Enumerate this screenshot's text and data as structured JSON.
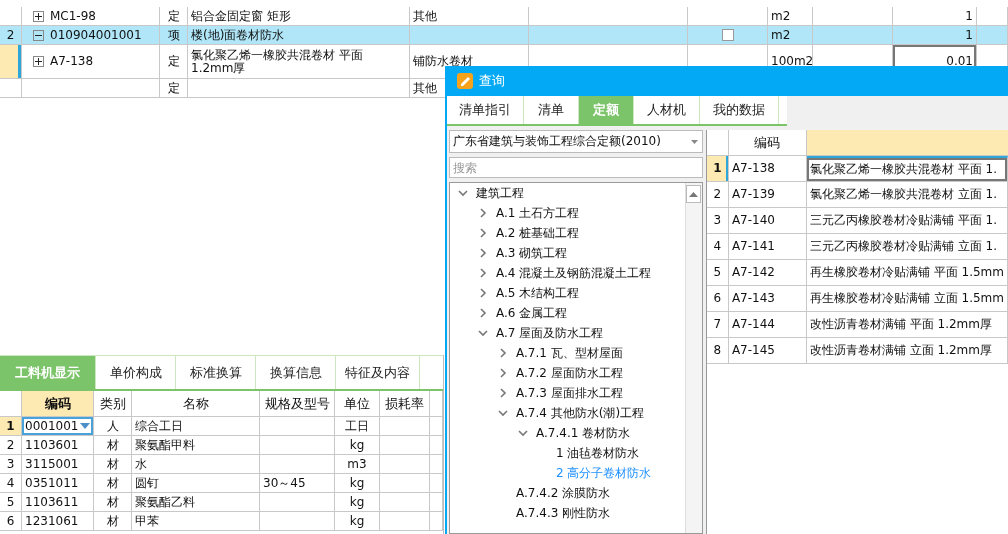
{
  "bill_table": {
    "rows": [
      {
        "no": "",
        "code": "MC1-98",
        "expanded": false,
        "type": "定",
        "name": "铝合金固定窗 矩形",
        "column_5": "其他",
        "unit": "m2",
        "qty": "1",
        "selected": false,
        "current": false
      },
      {
        "no": "2",
        "code": "010904001001",
        "expanded": true,
        "type": "项",
        "name": "楼(地)面卷材防水",
        "checkbox": false,
        "unit": "m2",
        "qty": "1",
        "selected": true,
        "current": false
      },
      {
        "no": "",
        "code": "A7-138",
        "expanded": false,
        "type": "定",
        "name": "氯化聚乙烯一橡胶共混卷材 平面 1.2mm厚",
        "column_5": "铺防水卷材",
        "unit": "100m2",
        "qty": "0.01",
        "selected": false,
        "current": true
      },
      {
        "no": "",
        "code": "",
        "type": "定",
        "name": "",
        "column_5": "其他",
        "unit": "",
        "qty": "",
        "selected": false,
        "current": false
      }
    ]
  },
  "detail_panel": {
    "tabs": [
      {
        "label": "工料机显示",
        "selected": true
      },
      {
        "label": "单价构成",
        "selected": false
      },
      {
        "label": "标准换算",
        "selected": false
      },
      {
        "label": "换算信息",
        "selected": false
      },
      {
        "label": "特征及内容",
        "selected": false
      }
    ],
    "columns": [
      {
        "label": "编码",
        "selected": true
      },
      {
        "label": "类别",
        "selected": false
      },
      {
        "label": "名称",
        "selected": false
      },
      {
        "label": "规格及型号",
        "selected": false
      },
      {
        "label": "单位",
        "selected": false
      },
      {
        "label": "损耗率",
        "selected": false
      }
    ],
    "rows": [
      {
        "no": "1",
        "code": "0001001",
        "type": "人",
        "name": "综合工日",
        "spec": "",
        "unit": "工日",
        "current": true
      },
      {
        "no": "2",
        "code": "1103601",
        "type": "材",
        "name": "聚氨酯甲料",
        "spec": "",
        "unit": "kg",
        "current": false
      },
      {
        "no": "3",
        "code": "3115001",
        "type": "材",
        "name": "水",
        "spec": "",
        "unit": "m3",
        "current": false
      },
      {
        "no": "4",
        "code": "0351011",
        "type": "材",
        "name": "圆钉",
        "spec": "30～45",
        "unit": "kg",
        "current": false
      },
      {
        "no": "5",
        "code": "1103611",
        "type": "材",
        "name": "聚氨酯乙料",
        "spec": "",
        "unit": "kg",
        "current": false
      },
      {
        "no": "6",
        "code": "1231061",
        "type": "材",
        "name": "甲苯",
        "spec": "",
        "unit": "kg",
        "current": false
      }
    ]
  },
  "query_dialog": {
    "title": "查询",
    "tabs": [
      {
        "label": "清单指引",
        "selected": false
      },
      {
        "label": "清单",
        "selected": false
      },
      {
        "label": "定额",
        "selected": true
      },
      {
        "label": "人材机",
        "selected": false
      },
      {
        "label": "我的数据",
        "selected": false
      }
    ],
    "library": "广东省建筑与装饰工程综合定额(2010)",
    "search": {
      "placeholder": "搜索"
    },
    "tree": [
      {
        "label": "建筑工程",
        "kind": "branch",
        "expanded": true,
        "selected": false,
        "children": [
          {
            "label": "A.1 土石方工程",
            "kind": "branch",
            "expanded": false,
            "selected": false
          },
          {
            "label": "A.2 桩基础工程",
            "kind": "branch",
            "expanded": false,
            "selected": false
          },
          {
            "label": "A.3 砌筑工程",
            "kind": "branch",
            "expanded": false,
            "selected": false
          },
          {
            "label": "A.4 混凝土及钢筋混凝土工程",
            "kind": "branch",
            "expanded": false,
            "selected": false
          },
          {
            "label": "A.5 木结构工程",
            "kind": "branch",
            "expanded": false,
            "selected": false
          },
          {
            "label": "A.6 金属工程",
            "kind": "branch",
            "expanded": false,
            "selected": false
          },
          {
            "label": "A.7 屋面及防水工程",
            "kind": "branch",
            "expanded": true,
            "selected": false,
            "children": [
              {
                "label": "A.7.1 瓦、型材屋面",
                "kind": "branch",
                "expanded": false,
                "selected": false
              },
              {
                "label": "A.7.2 屋面防水工程",
                "kind": "branch",
                "expanded": false,
                "selected": false
              },
              {
                "label": "A.7.3 屋面排水工程",
                "kind": "branch",
                "expanded": false,
                "selected": false
              },
              {
                "label": "A.7.4 其他防水(潮)工程",
                "kind": "branch",
                "expanded": true,
                "selected": false,
                "children": [
                  {
                    "label": "A.7.4.1 卷材防水",
                    "kind": "branch",
                    "expanded": true,
                    "selected": false,
                    "children": [
                      {
                        "label": "1 油毡卷材防水",
                        "kind": "leaf",
                        "selected": false
                      },
                      {
                        "label": "2 高分子卷材防水",
                        "kind": "leaf",
                        "selected": true
                      }
                    ]
                  },
                  {
                    "label": "A.7.4.2 涂膜防水",
                    "kind": "leaf",
                    "selected": false
                  },
                  {
                    "label": "A.7.4.3 刚性防水",
                    "kind": "leaf",
                    "selected": false
                  }
                ]
              }
            ]
          }
        ]
      }
    ],
    "results": {
      "columns": [
        {
          "label": "编码"
        }
      ],
      "rows": [
        {
          "no": "1",
          "code": "A7-138",
          "name": "氯化聚乙烯一橡胶共混卷材 平面 1.",
          "selected": true
        },
        {
          "no": "2",
          "code": "A7-139",
          "name": "氯化聚乙烯一橡胶共混卷材 立面 1.",
          "selected": false
        },
        {
          "no": "3",
          "code": "A7-140",
          "name": "三元乙丙橡胶卷材冷贴满铺 平面 1.",
          "selected": false
        },
        {
          "no": "4",
          "code": "A7-141",
          "name": "三元乙丙橡胶卷材冷贴满铺 立面 1.",
          "selected": false
        },
        {
          "no": "5",
          "code": "A7-142",
          "name": "再生橡胶卷材冷贴满铺 平面 1.5mm",
          "selected": false
        },
        {
          "no": "6",
          "code": "A7-143",
          "name": "再生橡胶卷材冷贴满铺 立面 1.5mm",
          "selected": false
        },
        {
          "no": "7",
          "code": "A7-144",
          "name": "改性沥青卷材满铺 平面 1.2mm厚",
          "selected": false
        },
        {
          "no": "8",
          "code": "A7-145",
          "name": "改性沥青卷材满铺 立面 1.2mm厚",
          "selected": false
        }
      ]
    }
  }
}
